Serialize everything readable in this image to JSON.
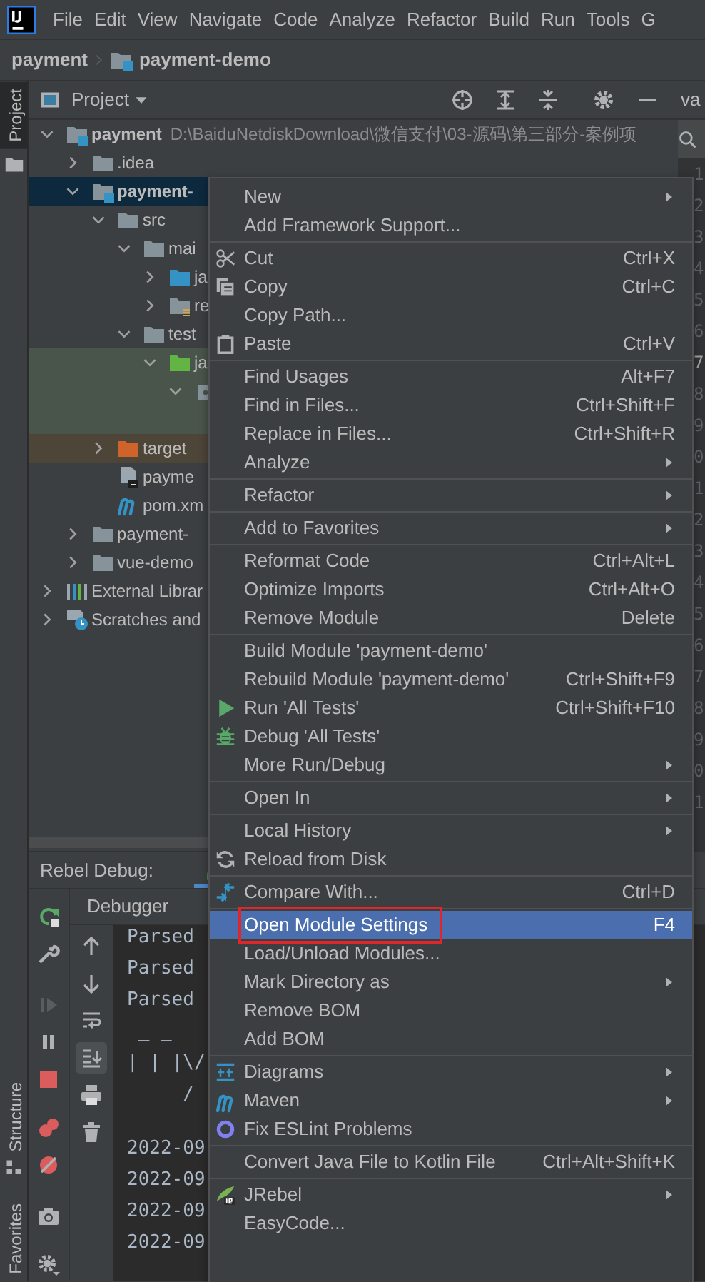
{
  "menubar": [
    {
      "label": "File"
    },
    {
      "label": "Edit"
    },
    {
      "label": "View"
    },
    {
      "label": "Navigate"
    },
    {
      "label": "Code"
    },
    {
      "label": "Analyze"
    },
    {
      "label": "Refactor"
    },
    {
      "label": "Build"
    },
    {
      "label": "Run"
    },
    {
      "label": "Tools"
    },
    {
      "label": "G"
    }
  ],
  "breadcrumb": [
    {
      "label": "payment",
      "kind": "project"
    },
    {
      "label": "payment-demo",
      "kind": "module"
    }
  ],
  "tool_strip": {
    "top": [
      {
        "label": "Project",
        "selected": true
      }
    ],
    "bottom": [
      {
        "label": "Structure",
        "selected": false
      },
      {
        "label": "Favorites",
        "selected": false
      }
    ]
  },
  "project_panel": {
    "title": "Project",
    "tree": [
      {
        "label": "payment",
        "path": "D:\\BaiduNetdiskDownload\\微信支付\\03-源码\\第三部分-案例项",
        "kind": "module",
        "expanded": true,
        "selected": false,
        "children": [
          {
            "label": ".idea",
            "kind": "folder",
            "expanded": false,
            "selected": false
          },
          {
            "label": "payment-",
            "kind": "module",
            "expanded": true,
            "selected": true,
            "children": [
              {
                "label": "src",
                "kind": "folder",
                "expanded": true,
                "selected": false,
                "children": [
                  {
                    "label": "mai",
                    "kind": "folder",
                    "expanded": true,
                    "selected": false,
                    "children": [
                      {
                        "label": "ja",
                        "kind": "source",
                        "expanded": false,
                        "selected": false
                      },
                      {
                        "label": "re",
                        "kind": "resources",
                        "expanded": false,
                        "selected": false
                      }
                    ]
                  },
                  {
                    "label": "test",
                    "kind": "folder",
                    "expanded": true,
                    "selected": false,
                    "children": [
                      {
                        "label": "ja",
                        "kind": "test-source",
                        "color": "#49544a",
                        "expanded": true,
                        "selected": false,
                        "children": [
                          {
                            "kind": "package",
                            "color": "#49544a",
                            "expanded": true,
                            "selected": false
                          }
                        ]
                      }
                    ]
                  }
                ]
              },
              {
                "label": "target",
                "kind": "excluded",
                "color": "#4d4538",
                "expanded": false,
                "selected": false
              },
              {
                "label": "payme",
                "kind": "file",
                "selected": false
              },
              {
                "label": "pom.xm",
                "kind": "maven",
                "selected": false
              }
            ]
          },
          {
            "label": "payment-",
            "kind": "folder",
            "expanded": false,
            "selected": false
          },
          {
            "label": "vue-demo",
            "kind": "folder",
            "expanded": false,
            "selected": false
          }
        ]
      },
      {
        "label": "External Librar",
        "kind": "libraries",
        "expanded": false,
        "selected": false
      },
      {
        "label": "Scratches and",
        "kind": "scratches",
        "expanded": false,
        "selected": false
      }
    ]
  },
  "editor": {
    "tab": "va",
    "gutter": [
      {
        "number": "1",
        "current": false
      },
      {
        "number": "2",
        "current": false
      },
      {
        "number": "3",
        "current": false
      },
      {
        "number": "4",
        "current": false
      },
      {
        "number": "5",
        "current": false
      },
      {
        "number": "6",
        "current": false
      },
      {
        "number": "7",
        "current": true
      },
      {
        "number": "8",
        "current": false
      },
      {
        "number": "9",
        "current": false
      },
      {
        "number": "0",
        "current": false
      },
      {
        "number": "1",
        "current": false
      },
      {
        "number": "2",
        "current": false
      },
      {
        "number": "3",
        "current": false
      },
      {
        "number": "4",
        "current": false
      },
      {
        "number": "5",
        "current": false
      },
      {
        "number": "6",
        "current": false
      },
      {
        "number": "7",
        "current": false
      },
      {
        "number": "8",
        "current": false
      },
      {
        "number": "9",
        "current": false
      },
      {
        "number": "0",
        "current": false
      },
      {
        "number": "1",
        "current": false
      }
    ]
  },
  "debug_panel": {
    "title": "Rebel Debug:",
    "tabs": [
      {
        "label": "Debugger"
      }
    ],
    "resume": {
      "disabled": true
    },
    "scroll_to_end": {
      "on": true
    },
    "console_blocks": [
      {
        "lines": [
          "Parsed",
          "Parsed",
          "Parsed",
          " _ _",
          "| | |\\/",
          "     /"
        ]
      },
      {
        "lines": [
          "2022-09",
          "2022-09",
          "2022-09",
          "2022-09"
        ]
      }
    ]
  },
  "context_menu": {
    "groups": [
      {
        "items": [
          {
            "label": "New",
            "submenu": true,
            "selected": false,
            "annotated": false
          },
          {
            "label": "Add Framework Support...",
            "submenu": false,
            "selected": false,
            "annotated": false
          }
        ]
      },
      {
        "items": [
          {
            "label": "Cut",
            "shortcut": "Ctrl+X",
            "kind": "cut",
            "submenu": false,
            "selected": false,
            "annotated": false
          },
          {
            "label": "Copy",
            "shortcut": "Ctrl+C",
            "kind": "copy",
            "submenu": false,
            "selected": false,
            "annotated": false
          },
          {
            "label": "Copy Path...",
            "submenu": false,
            "selected": false,
            "annotated": false
          },
          {
            "label": "Paste",
            "shortcut": "Ctrl+V",
            "kind": "paste",
            "submenu": false,
            "selected": false,
            "annotated": false
          }
        ]
      },
      {
        "items": [
          {
            "label": "Find Usages",
            "shortcut": "Alt+F7",
            "submenu": false,
            "selected": false,
            "annotated": false
          },
          {
            "label": "Find in Files...",
            "shortcut": "Ctrl+Shift+F",
            "submenu": false,
            "selected": false,
            "annotated": false
          },
          {
            "label": "Replace in Files...",
            "shortcut": "Ctrl+Shift+R",
            "submenu": false,
            "selected": false,
            "annotated": false
          },
          {
            "label": "Analyze",
            "submenu": true,
            "selected": false,
            "annotated": false
          }
        ]
      },
      {
        "items": [
          {
            "label": "Refactor",
            "submenu": true,
            "selected": false,
            "annotated": false
          }
        ]
      },
      {
        "items": [
          {
            "label": "Add to Favorites",
            "submenu": true,
            "selected": false,
            "annotated": false
          }
        ]
      },
      {
        "items": [
          {
            "label": "Reformat Code",
            "shortcut": "Ctrl+Alt+L",
            "submenu": false,
            "selected": false,
            "annotated": false
          },
          {
            "label": "Optimize Imports",
            "shortcut": "Ctrl+Alt+O",
            "submenu": false,
            "selected": false,
            "annotated": false
          },
          {
            "label": "Remove Module",
            "shortcut": "Delete",
            "submenu": false,
            "selected": false,
            "annotated": false
          }
        ]
      },
      {
        "items": [
          {
            "label": "Build Module 'payment-demo'",
            "submenu": false,
            "selected": false,
            "annotated": false
          },
          {
            "label": "Rebuild Module 'payment-demo'",
            "shortcut": "Ctrl+Shift+F9",
            "submenu": false,
            "selected": false,
            "annotated": false
          },
          {
            "label": "Run 'All Tests'",
            "shortcut": "Ctrl+Shift+F10",
            "kind": "run",
            "submenu": false,
            "selected": false,
            "annotated": false
          },
          {
            "label": "Debug 'All Tests'",
            "kind": "debug",
            "submenu": false,
            "selected": false,
            "annotated": false
          },
          {
            "label": "More Run/Debug",
            "submenu": true,
            "selected": false,
            "annotated": false
          }
        ]
      },
      {
        "items": [
          {
            "label": "Open In",
            "submenu": true,
            "selected": false,
            "annotated": false
          }
        ]
      },
      {
        "items": [
          {
            "label": "Local History",
            "submenu": true,
            "selected": false,
            "annotated": false
          },
          {
            "label": "Reload from Disk",
            "kind": "reload",
            "submenu": false,
            "selected": false,
            "annotated": false
          }
        ]
      },
      {
        "items": [
          {
            "label": "Compare With...",
            "shortcut": "Ctrl+D",
            "kind": "compare",
            "submenu": false,
            "selected": false,
            "annotated": false
          }
        ]
      },
      {
        "items": [
          {
            "label": "Open Module Settings",
            "shortcut": "F4",
            "submenu": false,
            "selected": true,
            "annotated": true
          },
          {
            "label": "Load/Unload Modules...",
            "submenu": false,
            "selected": false,
            "annotated": false
          },
          {
            "label": "Mark Directory as",
            "submenu": true,
            "selected": false,
            "annotated": false
          },
          {
            "label": "Remove BOM",
            "submenu": false,
            "selected": false,
            "annotated": false
          },
          {
            "label": "Add BOM",
            "submenu": false,
            "selected": false,
            "annotated": false
          }
        ]
      },
      {
        "items": [
          {
            "label": "Diagrams",
            "kind": "diagrams",
            "submenu": true,
            "selected": false,
            "annotated": false
          },
          {
            "label": "Maven",
            "kind": "maven",
            "submenu": true,
            "selected": false,
            "annotated": false
          },
          {
            "label": "Fix ESLint Problems",
            "kind": "eslint",
            "submenu": false,
            "selected": false,
            "annotated": false
          }
        ]
      },
      {
        "items": [
          {
            "label": "Convert Java File to Kotlin File",
            "shortcut": "Ctrl+Alt+Shift+K",
            "submenu": false,
            "selected": false,
            "annotated": false
          }
        ]
      },
      {
        "items": [
          {
            "label": "JRebel",
            "kind": "jrebel",
            "submenu": true,
            "selected": false,
            "annotated": false
          },
          {
            "label": "EasyCode...",
            "submenu": false,
            "selected": false,
            "annotated": false
          }
        ]
      }
    ]
  }
}
